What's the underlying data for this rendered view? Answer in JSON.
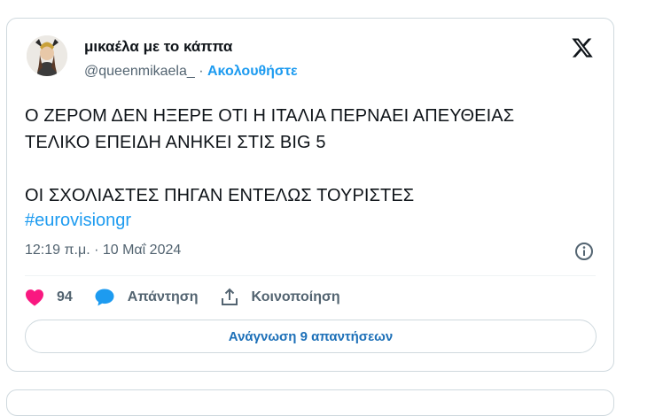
{
  "tweet": {
    "display_name": "μικαέλα με το κάππα",
    "handle": "@queenmikaela_",
    "separator": "·",
    "follow_label": "Ακολουθήστε",
    "text": "Ο ΖΕΡΟΜ ΔΕΝ ΗΞΕΡΕ ΟΤΙ Η ΙΤΑΛΙΑ ΠΕΡΝΑΕΙ ΑΠΕΥΘΕΙΑΣ\nΤΕΛΙΚΟ ΕΠΕΙΔΗ ΑΝΗΚΕΙ ΣΤΙΣ BIG 5\n\nΟΙ ΣΧΟΛΙΑΣΤΕΣ ΠΗΓΑΝ ΕΝΤΕΛΩΣ ΤΟΥΡΙΣΤΕΣ",
    "hashtag": "#eurovisiongr",
    "timestamp": "12:19 π.μ. · 10 Μαΐ 2024",
    "likes": "94",
    "reply_label": "Απάντηση",
    "share_label": "Κοινοποίηση",
    "read_replies_label": "Ανάγνωση 9 απαντήσεων"
  },
  "colors": {
    "accent": "#1d9bf0",
    "heart": "#f91880",
    "border": "#cfd9de",
    "secondary_text": "#536471"
  },
  "icons": [
    "avatar",
    "x-logo-icon",
    "info-icon",
    "heart-icon",
    "reply-bubble-icon",
    "share-icon"
  ]
}
